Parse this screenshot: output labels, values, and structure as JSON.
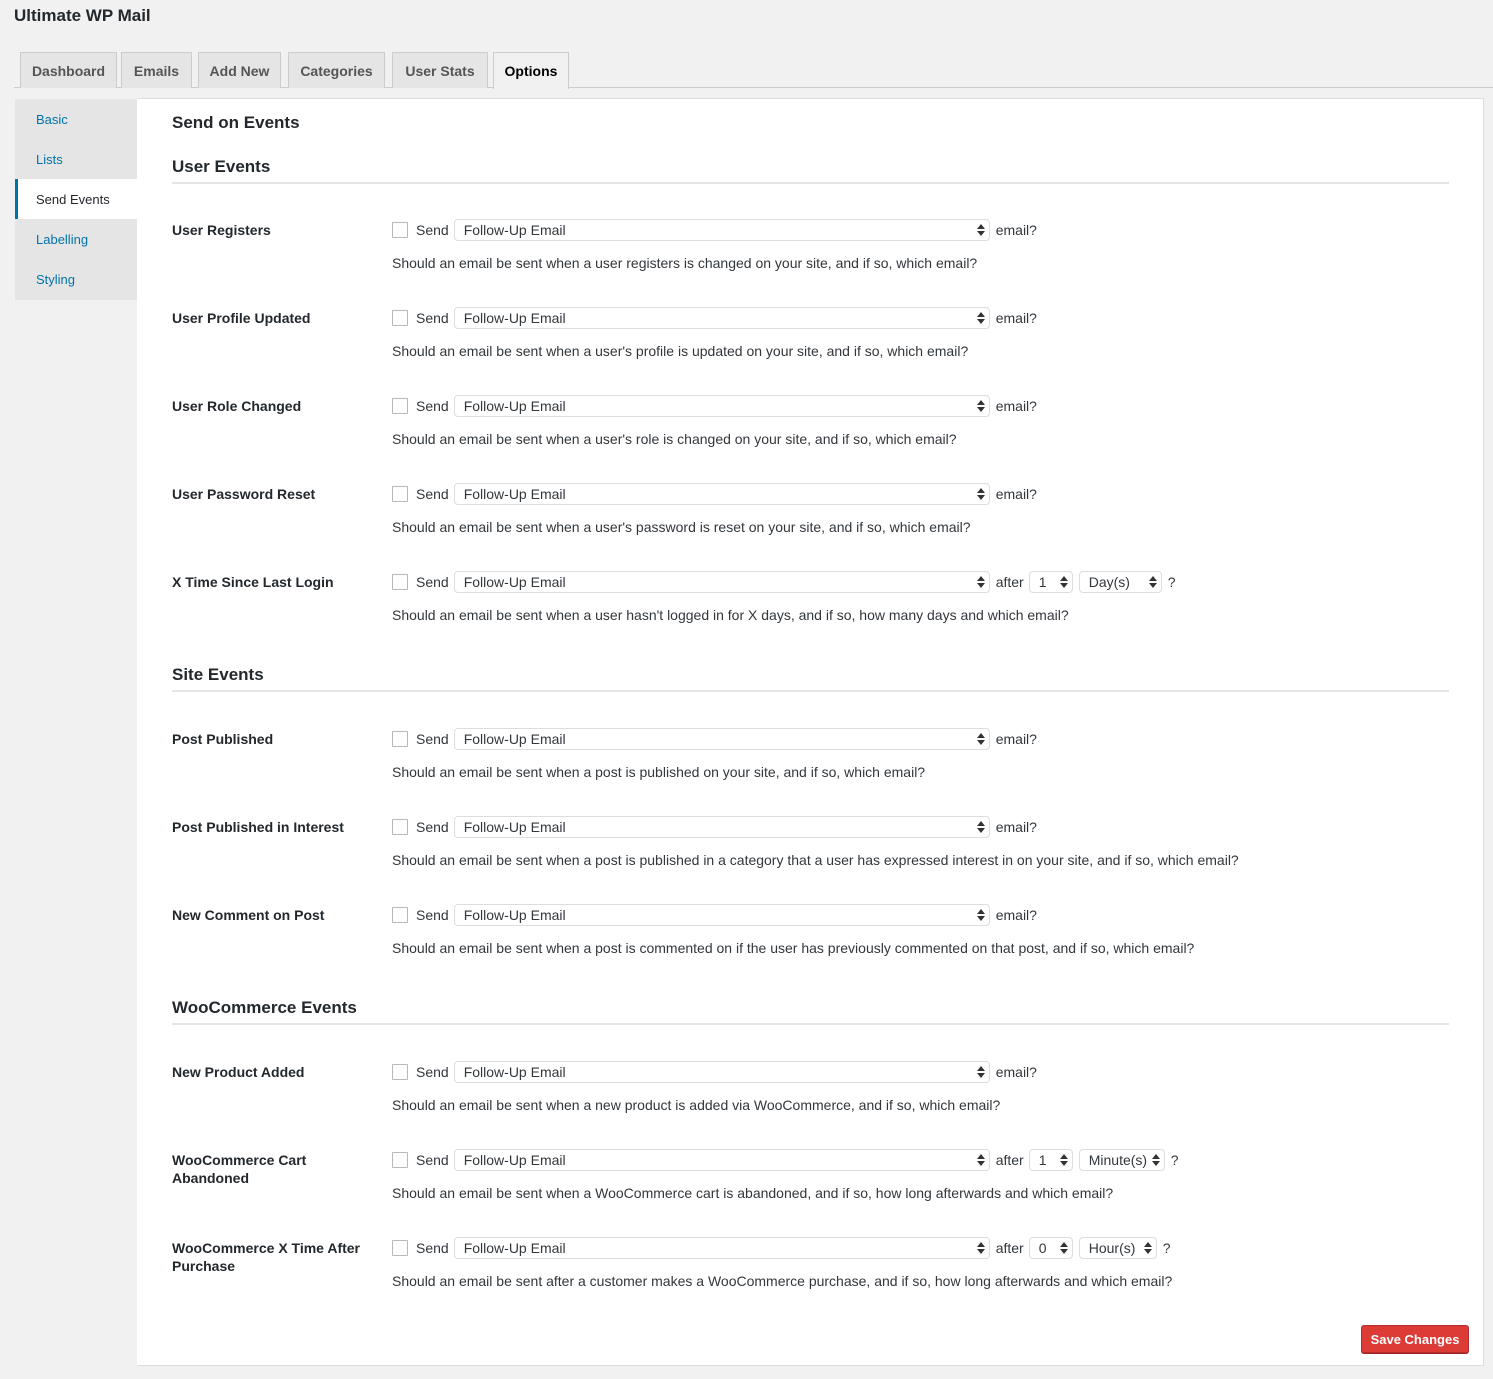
{
  "app_title": "Ultimate WP Mail",
  "tabs": [
    {
      "label": "Dashboard",
      "active": false
    },
    {
      "label": "Emails",
      "active": false
    },
    {
      "label": "Add New",
      "active": false
    },
    {
      "label": "Categories",
      "active": false
    },
    {
      "label": "User Stats",
      "active": false
    },
    {
      "label": "Options",
      "active": true
    }
  ],
  "sidebar": {
    "items": [
      {
        "label": "Basic",
        "active": false
      },
      {
        "label": "Lists",
        "active": false
      },
      {
        "label": "Send Events",
        "active": true
      },
      {
        "label": "Labelling",
        "active": false
      },
      {
        "label": "Styling",
        "active": false
      }
    ]
  },
  "page_title": "Send on Events",
  "common": {
    "send_label": "Send",
    "email_suffix": "email?",
    "after_label": "after",
    "question_mark": "?"
  },
  "sections": [
    {
      "title": "User Events",
      "rows": [
        {
          "label": "User Registers",
          "checked": false,
          "email": "Follow-Up Email",
          "desc": "Should an email be sent when a user registers is changed on your site, and if so, which email?"
        },
        {
          "label": "User Profile Updated",
          "checked": false,
          "email": "Follow-Up Email",
          "desc": "Should an email be sent when a user's profile is updated on your site, and if so, which email?"
        },
        {
          "label": "User Role Changed",
          "checked": false,
          "email": "Follow-Up Email",
          "desc": "Should an email be sent when a user's role is changed on your site, and if so, which email?"
        },
        {
          "label": "User Password Reset",
          "checked": false,
          "email": "Follow-Up Email",
          "desc": "Should an email be sent when a user's password is reset on your site, and if so, which email?"
        },
        {
          "label": "X Time Since Last Login",
          "checked": false,
          "email": "Follow-Up Email",
          "after_value": "1",
          "after_unit": "Day(s)",
          "desc": "Should an email be sent when a user hasn't logged in for X days, and if so, how many days and which email?"
        }
      ]
    },
    {
      "title": "Site Events",
      "rows": [
        {
          "label": "Post Published",
          "checked": false,
          "email": "Follow-Up Email",
          "desc": "Should an email be sent when a post is published on your site, and if so, which email?"
        },
        {
          "label": "Post Published in Interest",
          "checked": false,
          "email": "Follow-Up Email",
          "desc": "Should an email be sent when a post is published in a category that a user has expressed interest in on your site, and if so, which email?"
        },
        {
          "label": "New Comment on Post",
          "checked": false,
          "email": "Follow-Up Email",
          "desc": "Should an email be sent when a post is commented on if the user has previously commented on that post, and if so, which email?"
        }
      ]
    },
    {
      "title": "WooCommerce Events",
      "rows": [
        {
          "label": "New Product Added",
          "checked": false,
          "email": "Follow-Up Email",
          "desc": "Should an email be sent when a new product is added via WooCommerce, and if so, which email?"
        },
        {
          "label": "WooCommerce Cart Abandoned",
          "checked": false,
          "email": "Follow-Up Email",
          "after_value": "1",
          "after_unit": "Minute(s)",
          "desc": "Should an email be sent when a WooCommerce cart is abandoned, and if so, how long afterwards and which email?"
        },
        {
          "label": "WooCommerce X Time After Purchase",
          "checked": false,
          "email": "Follow-Up Email",
          "after_value": "0",
          "after_unit": "Hour(s)",
          "desc": "Should an email be sent after a customer makes a WooCommerce purchase, and if so, how long afterwards and which email?"
        }
      ]
    }
  ],
  "save_button": "Save Changes"
}
